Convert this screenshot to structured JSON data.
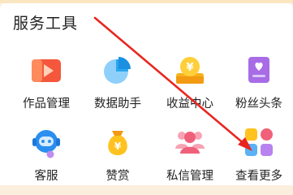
{
  "section": {
    "title": "服务工具"
  },
  "tools": [
    {
      "label": "作品管理",
      "icon": "video-play-icon",
      "color": "#f5573c"
    },
    {
      "label": "数据助手",
      "icon": "pie-chart-icon",
      "color": "#2aa5f0"
    },
    {
      "label": "收益中心",
      "icon": "yen-coin-icon",
      "color": "#f7b21b"
    },
    {
      "label": "粉丝头条",
      "icon": "heart-card-icon",
      "color": "#a76ce6"
    },
    {
      "label": "客服",
      "icon": "headset-robot-icon",
      "color": "#2a8ff0"
    },
    {
      "label": "赞赏",
      "icon": "yen-bag-icon",
      "color": "#f7b21b"
    },
    {
      "label": "私信管理",
      "icon": "users-chat-icon",
      "color": "#f0607a"
    },
    {
      "label": "查看更多",
      "icon": "more-grid-icon",
      "color": "#f7b21b"
    }
  ],
  "annotation": {
    "arrow_color": "#e8261f"
  }
}
